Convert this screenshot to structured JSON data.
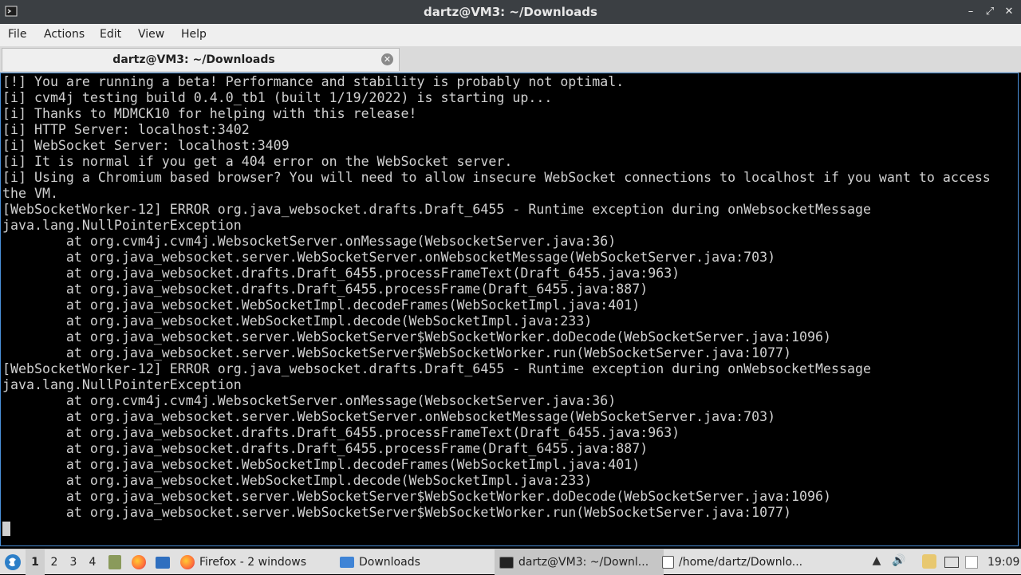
{
  "window": {
    "title": "dartz@VM3: ~/Downloads",
    "controls": [
      "minimize-icon",
      "maximize-icon",
      "close-icon"
    ]
  },
  "menu": [
    "File",
    "Actions",
    "Edit",
    "View",
    "Help"
  ],
  "tab": {
    "title": "dartz@VM3: ~/Downloads",
    "close_glyph": "✕"
  },
  "terminal": {
    "lines": [
      "[!] You are running a beta! Performance and stability is probably not optimal.",
      "[i] cvm4j testing build 0.4.0_tb1 (built 1/19/2022) is starting up...",
      "[i] Thanks to MDMCK10 for helping with this release!",
      "[i] HTTP Server: localhost:3402",
      "[i] WebSocket Server: localhost:3409",
      "[i] It is normal if you get a 404 error on the WebSocket server.",
      "[i] Using a Chromium based browser? You will need to allow insecure WebSocket connections to localhost if you want to access",
      "the VM.",
      "[WebSocketWorker-12] ERROR org.java_websocket.drafts.Draft_6455 - Runtime exception during onWebsocketMessage",
      "java.lang.NullPointerException",
      "        at org.cvm4j.cvm4j.WebsocketServer.onMessage(WebsocketServer.java:36)",
      "        at org.java_websocket.server.WebSocketServer.onWebsocketMessage(WebSocketServer.java:703)",
      "        at org.java_websocket.drafts.Draft_6455.processFrameText(Draft_6455.java:963)",
      "        at org.java_websocket.drafts.Draft_6455.processFrame(Draft_6455.java:887)",
      "        at org.java_websocket.WebSocketImpl.decodeFrames(WebSocketImpl.java:401)",
      "        at org.java_websocket.WebSocketImpl.decode(WebSocketImpl.java:233)",
      "        at org.java_websocket.server.WebSocketServer$WebSocketWorker.doDecode(WebSocketServer.java:1096)",
      "        at org.java_websocket.server.WebSocketServer$WebSocketWorker.run(WebSocketServer.java:1077)",
      "[WebSocketWorker-12] ERROR org.java_websocket.drafts.Draft_6455 - Runtime exception during onWebsocketMessage",
      "java.lang.NullPointerException",
      "        at org.cvm4j.cvm4j.WebsocketServer.onMessage(WebsocketServer.java:36)",
      "        at org.java_websocket.server.WebSocketServer.onWebsocketMessage(WebSocketServer.java:703)",
      "        at org.java_websocket.drafts.Draft_6455.processFrameText(Draft_6455.java:963)",
      "        at org.java_websocket.drafts.Draft_6455.processFrame(Draft_6455.java:887)",
      "        at org.java_websocket.WebSocketImpl.decodeFrames(WebSocketImpl.java:401)",
      "        at org.java_websocket.WebSocketImpl.decode(WebSocketImpl.java:233)",
      "        at org.java_websocket.server.WebSocketServer$WebSocketWorker.doDecode(WebSocketServer.java:1096)",
      "        at org.java_websocket.server.WebSocketServer$WebSocketWorker.run(WebSocketServer.java:1077)"
    ]
  },
  "taskbar": {
    "desktops": [
      "1",
      "2",
      "3",
      "4"
    ],
    "active_desktop": "1",
    "tasks": [
      {
        "label": "Firefox - 2 windows",
        "icon": "firefox-icon"
      },
      {
        "label": "Downloads",
        "icon": "folder-icon"
      },
      {
        "label": "dartz@VM3: ~/Downl...",
        "icon": "terminal-icon",
        "active": true
      },
      {
        "label": "/home/dartz/Downlo...",
        "icon": "text-editor-icon"
      }
    ],
    "clock": "19:09"
  },
  "colors": {
    "titlebar": "#3b3f43",
    "terminal_bg": "#000000",
    "terminal_fg": "#d0d0d0",
    "accent": "#4a90d9",
    "firefox": "#ff7139"
  }
}
